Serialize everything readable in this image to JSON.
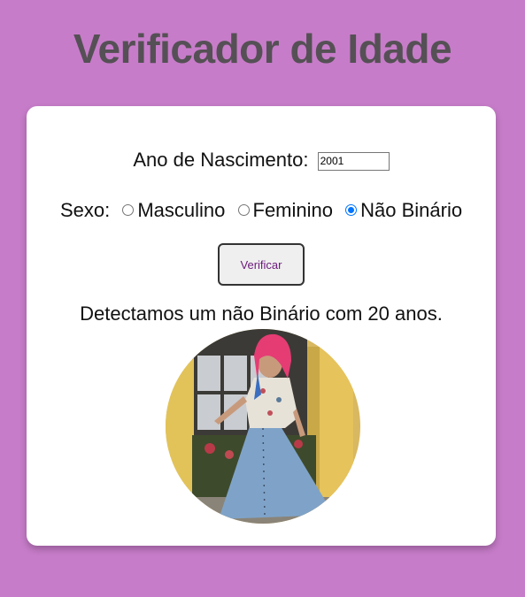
{
  "page": {
    "title": "Verificador de Idade"
  },
  "form": {
    "year_label": "Ano de Nascimento:",
    "year_value": "2001",
    "sex_label": "Sexo:",
    "sex_options": [
      {
        "label": "Masculino",
        "checked": false
      },
      {
        "label": "Feminino",
        "checked": false
      },
      {
        "label": "Não Binário",
        "checked": true
      }
    ],
    "verify_button": "Verificar"
  },
  "result": {
    "text": "Detectamos um não Binário com 20 anos."
  },
  "colors": {
    "background": "#c77cc9",
    "card": "#ffffff",
    "title": "#555055",
    "radio_accent": "#0075ff"
  }
}
